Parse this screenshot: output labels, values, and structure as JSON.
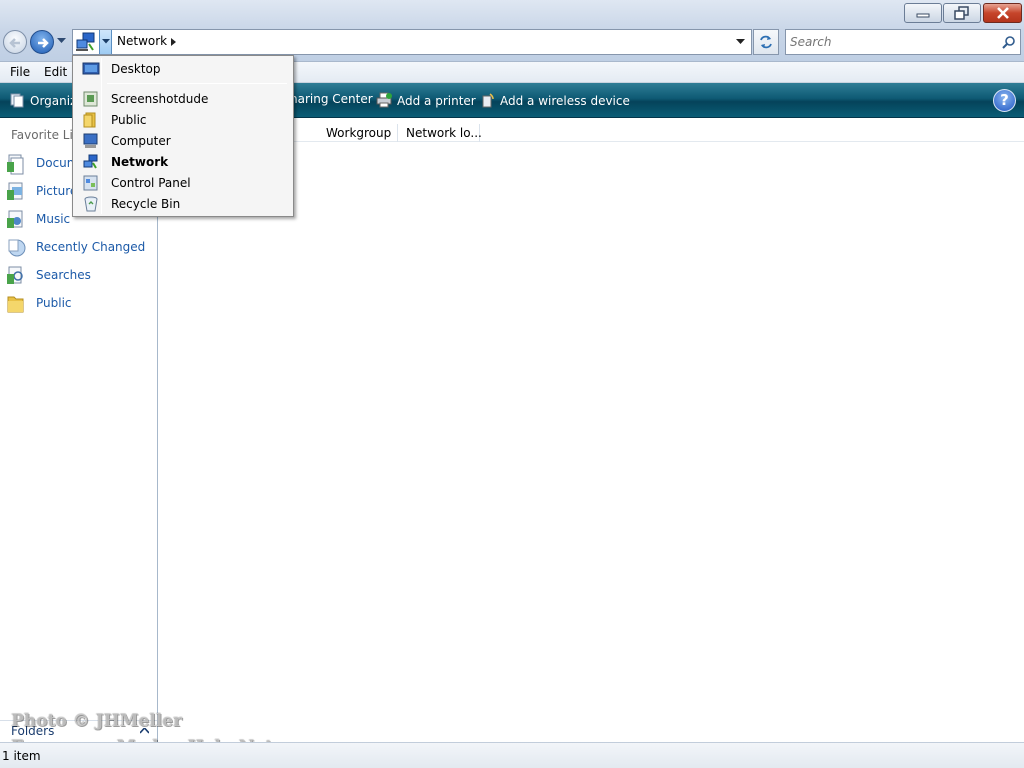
{
  "window": {
    "address_location": "Network",
    "search_placeholder": "Search",
    "icons": {
      "back": "back-arrow-icon",
      "forward": "forward-arrow-icon",
      "refresh": "refresh-icon",
      "search": "magnifier-icon",
      "minimize": "minimize-icon",
      "maximize": "restore-icon",
      "close": "close-icon"
    }
  },
  "menubar": {
    "file": "File",
    "edit": "Edit"
  },
  "commandbar": {
    "organize": "Organiz",
    "sharing_center": "haring Center",
    "add_printer": "Add a printer",
    "add_wireless": "Add a wireless device",
    "help": "?"
  },
  "navpane": {
    "title": "Favorite Lin",
    "items": [
      {
        "label": "Docum",
        "icon": "documents-icon"
      },
      {
        "label": "Picture",
        "icon": "pictures-icon"
      },
      {
        "label": "Music",
        "icon": "music-icon"
      },
      {
        "label": "Recently Changed",
        "icon": "recently-changed-icon"
      },
      {
        "label": "Searches",
        "icon": "searches-icon"
      },
      {
        "label": "Public",
        "icon": "folder-icon"
      }
    ],
    "folders_label": "Folders"
  },
  "content": {
    "columns": [
      "Workgroup",
      "Network lo..."
    ]
  },
  "dropdown": {
    "items": [
      {
        "label": "Desktop",
        "icon": "desktop-icon"
      },
      {
        "label": "Screenshotdude",
        "icon": "user-folder-icon"
      },
      {
        "label": "Public",
        "icon": "folder-icon"
      },
      {
        "label": "Computer",
        "icon": "computer-icon"
      },
      {
        "label": "Network",
        "icon": "network-icon",
        "selected": true
      },
      {
        "label": "Control Panel",
        "icon": "control-panel-icon"
      },
      {
        "label": "Recycle Bin",
        "icon": "recycle-bin-icon"
      }
    ]
  },
  "statusbar": {
    "text": "1 item"
  },
  "watermark": {
    "line1": "Photo © JHMeller",
    "line2": "For use on ModemHelp.Net"
  },
  "colors": {
    "link": "#1c5aa8",
    "command_bar": "#0e5a74",
    "accent": "#2057c4"
  }
}
